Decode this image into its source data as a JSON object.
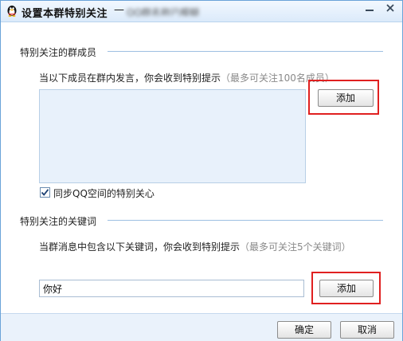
{
  "window": {
    "title": "设置本群特别关注",
    "title_dash": "—",
    "group_name_blurred": "QQ群名称已模糊",
    "app_icon": "qq-penguin-icon",
    "minimize_icon": "minimize-icon",
    "close_icon": "close-icon"
  },
  "members_section": {
    "heading": "特别关注的群成员",
    "hint_main": "当以下成员在群内发言，你会收到特别提示",
    "hint_note": "（最多可关注100名成员）",
    "add_label": "添加",
    "sync_checkbox": {
      "label": "同步QQ空间的特别关心",
      "checked": true
    }
  },
  "keywords_section": {
    "heading": "特别关注的关键词",
    "hint_main": "当群消息中包含以下关键词，你会收到特别提示",
    "hint_note": "（最多可关注5个关键词）",
    "keyword_value": "你好",
    "add_label": "添加"
  },
  "footer": {
    "ok_label": "确定",
    "cancel_label": "取消"
  },
  "colors": {
    "accent_border": "#6aa3d8",
    "list_background": "#e8f1fb",
    "highlight": "#e02020"
  }
}
